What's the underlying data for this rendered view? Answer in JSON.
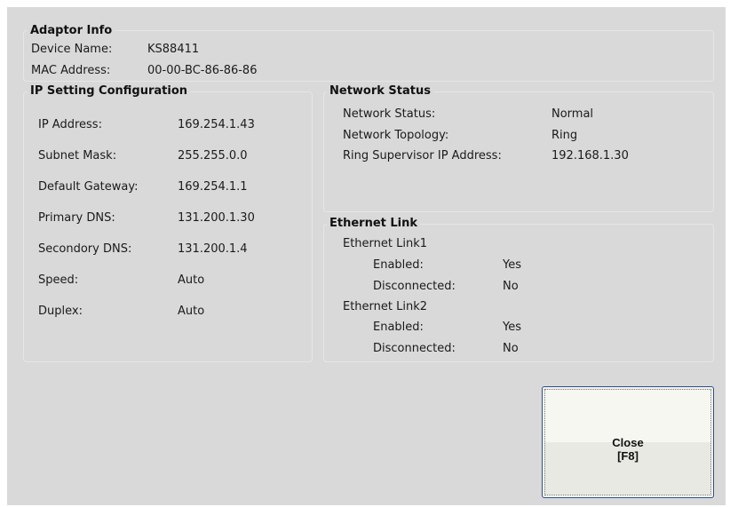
{
  "adaptor_info": {
    "title": "Adaptor Info",
    "device_name_label": "Device Name:",
    "device_name_value": "KS88411",
    "mac_address_label": "MAC Address:",
    "mac_address_value": "00-00-BC-86-86-86"
  },
  "ip_settings": {
    "title": "IP Setting Configuration",
    "rows": [
      {
        "label": "IP Address:",
        "value": "169.254.1.43"
      },
      {
        "label": "Subnet Mask:",
        "value": "255.255.0.0"
      },
      {
        "label": "Default Gateway:",
        "value": "169.254.1.1"
      },
      {
        "label": "Primary DNS:",
        "value": "131.200.1.30"
      },
      {
        "label": "Secondory DNS:",
        "value": "131.200.1.4"
      },
      {
        "label": "Speed:",
        "value": "Auto"
      },
      {
        "label": "Duplex:",
        "value": "Auto"
      }
    ]
  },
  "network_status": {
    "title": "Network Status",
    "rows": [
      {
        "label": "Network Status:",
        "value": "Normal"
      },
      {
        "label": "Network Topology:",
        "value": "Ring"
      },
      {
        "label": "Ring Supervisor IP Address:",
        "value": "192.168.1.30"
      }
    ]
  },
  "ethernet_link": {
    "title": "Ethernet Link",
    "links": [
      {
        "name": "Ethernet Link1",
        "enabled_label": "Enabled:",
        "enabled_value": "Yes",
        "disconnected_label": "Disconnected:",
        "disconnected_value": "No"
      },
      {
        "name": "Ethernet Link2",
        "enabled_label": "Enabled:",
        "enabled_value": "Yes",
        "disconnected_label": "Disconnected:",
        "disconnected_value": "No"
      }
    ]
  },
  "close_button": {
    "line1": "Close",
    "line2": "[F8]"
  }
}
